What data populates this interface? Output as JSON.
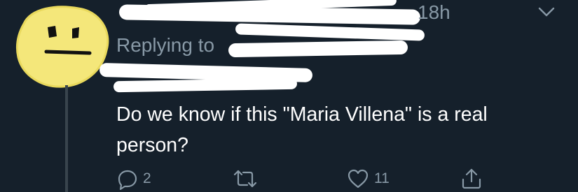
{
  "tweet": {
    "timestamp": "18h",
    "replying_to_label": "Replying to",
    "text": "Do we know if this \"Maria Villena\" is a real person?",
    "avatar_icon": "neutral-face-drawing-icon",
    "menu_icon": "chevron-down-icon"
  },
  "actions": {
    "reply": {
      "icon": "reply-icon",
      "count": "2"
    },
    "retweet": {
      "icon": "retweet-icon",
      "count": ""
    },
    "like": {
      "icon": "heart-icon",
      "count": "11"
    },
    "share": {
      "icon": "share-icon",
      "count": ""
    }
  },
  "colors": {
    "background": "#15202b",
    "secondary_text": "#8899a6",
    "primary_text": "#ffffff",
    "avatar_yellow": "#f4e77a",
    "redaction": "#ffffff"
  }
}
